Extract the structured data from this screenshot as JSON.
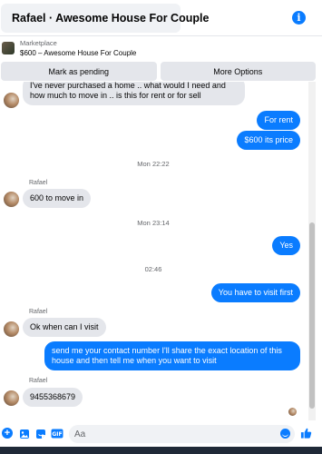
{
  "header": {
    "title": "Rafael · Awesome House For Couple",
    "info_icon": "info-icon",
    "avatar_icon": "house-avatar"
  },
  "marketplace": {
    "label": "Marketplace",
    "item": "$600 – Awesome House For Couple"
  },
  "actions": {
    "pending_label": "Mark as pending",
    "more_label": "More Options"
  },
  "messages": {
    "m1": "I've never purchased a home .. what would I need and how much to move in .. is this for rent or for sell",
    "m2": "For rent",
    "m3": "$600 its price",
    "t1": "Mon 22:22",
    "s1": "Rafael",
    "m4": "600 to move in",
    "t2": "Mon 23:14",
    "m5": "Yes",
    "t3": "02:46",
    "m6": "You have to visit first",
    "s2": "Rafael",
    "m7": "Ok when can I visit",
    "m8": "send me your contact number I'll share the exact location of this house and then tell me when you want to visit",
    "s3": "Rafael",
    "m9": "9455368679"
  },
  "composer": {
    "placeholder": "Aa",
    "icons": [
      "plus-icon",
      "photo-icon",
      "sticker-icon",
      "gif-icon",
      "emoji-icon",
      "like-icon"
    ]
  },
  "colors": {
    "accent": "#0a7cff",
    "incoming_bubble": "#e4e6eb"
  }
}
